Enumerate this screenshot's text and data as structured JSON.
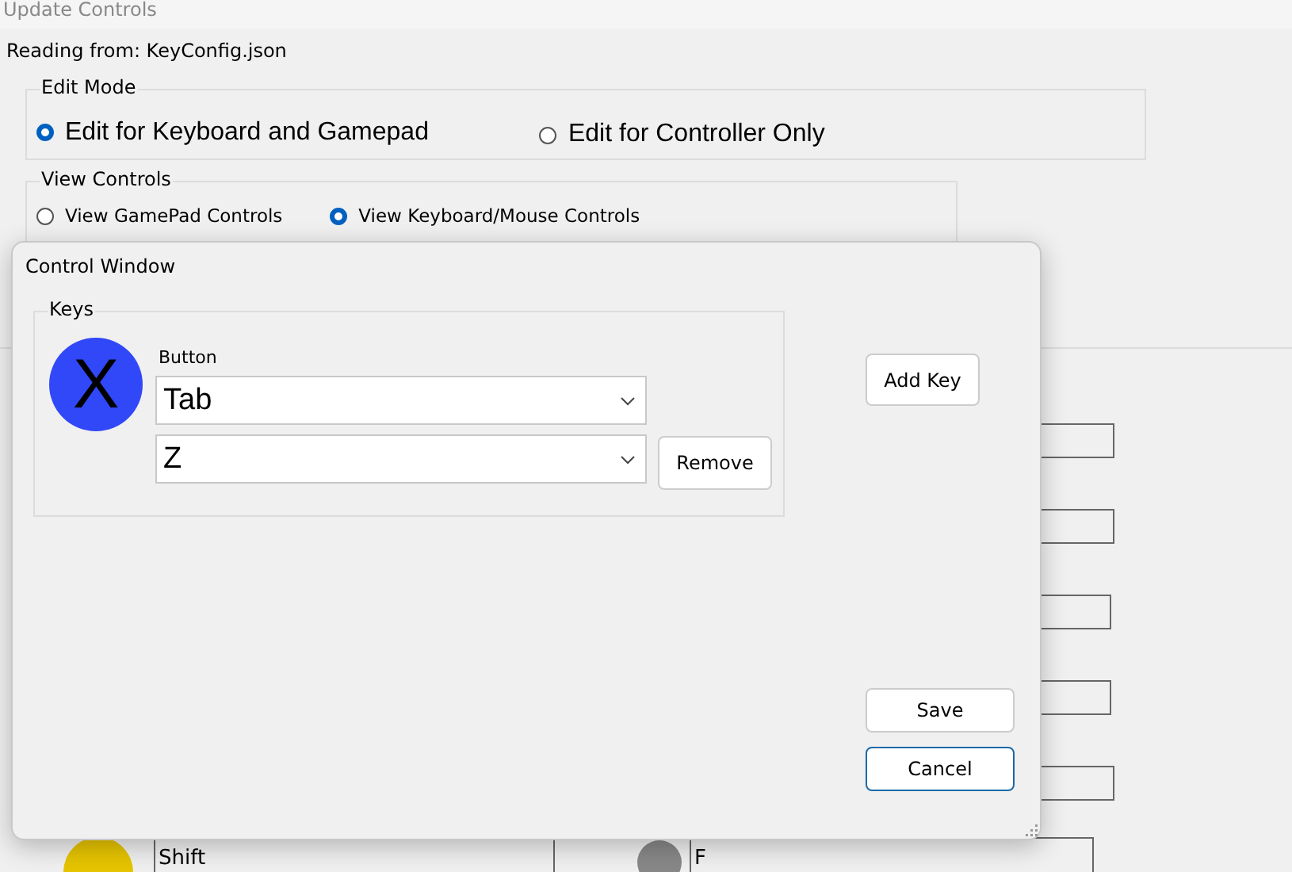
{
  "window": {
    "title": "Update Controls"
  },
  "source_label": "Reading from: KeyConfig.json",
  "edit_mode": {
    "legend": "Edit Mode",
    "options": [
      {
        "label": "Edit for Keyboard and Gamepad",
        "selected": true
      },
      {
        "label": "Edit for Controller Only",
        "selected": false
      }
    ]
  },
  "view_controls": {
    "legend": "View Controls",
    "options": [
      {
        "label": "View GamePad Controls",
        "selected": false
      },
      {
        "label": "View Keyboard/Mouse Controls",
        "selected": true
      }
    ]
  },
  "bottom_row": {
    "key_value": "Shift",
    "second_value": "F"
  },
  "dialog": {
    "title": "Control Window",
    "keys": {
      "legend": "Keys",
      "glyph": "X",
      "field_label": "Button",
      "bindings": [
        {
          "value": "Tab"
        },
        {
          "value": "Z"
        }
      ],
      "remove_label": "Remove"
    },
    "add_key_button": "Add Key",
    "buttons": [
      {
        "label": "Save",
        "focused": false
      },
      {
        "label": "Cancel",
        "focused": true
      }
    ]
  }
}
